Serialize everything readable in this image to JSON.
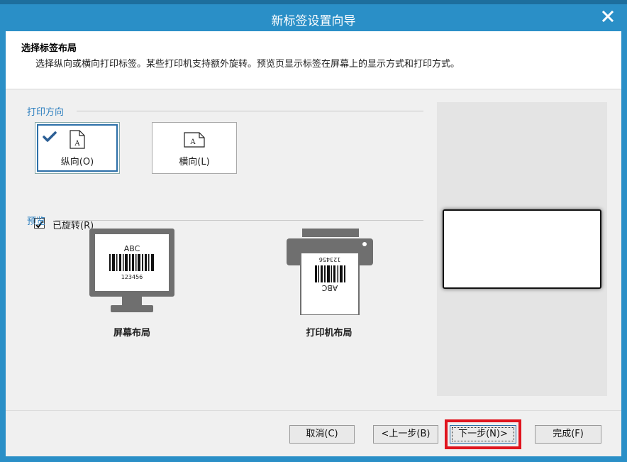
{
  "window": {
    "title": "新标签设置向导"
  },
  "header": {
    "title": "选择标签布局",
    "description": "选择纵向或横向打印标签。某些打印机支持额外旋转。预览页显示标签在屏幕上的显示方式和打印方式。"
  },
  "orientation": {
    "section_label": "打印方向",
    "portrait_label": "纵向(O)",
    "landscape_label": "横向(L)",
    "selected": "portrait",
    "doc_letter": "A"
  },
  "rotate": {
    "label": "已旋转(R)",
    "checked": true
  },
  "preview": {
    "section_label": "预览",
    "screen_caption": "屏幕布局",
    "printer_caption": "打印机布局",
    "barcode_top_text": "ABC",
    "barcode_number": "123456"
  },
  "footer": {
    "cancel": "取消(C)",
    "back": "<上一步(B)",
    "next": "下一步(N)>",
    "finish": "完成(F)"
  },
  "colors": {
    "titlebar": "#2a8fc7",
    "section_label": "#2d7fbf",
    "highlight": "#e0141e"
  }
}
